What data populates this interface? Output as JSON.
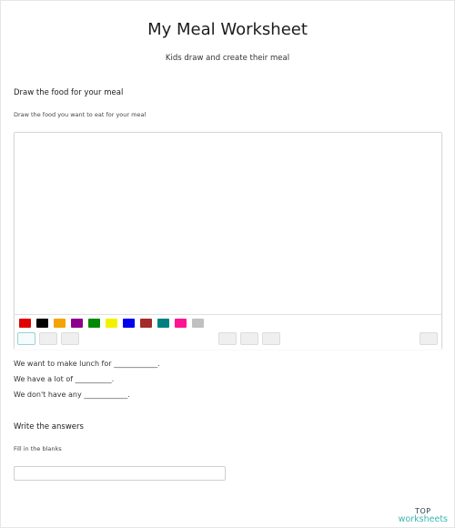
{
  "header": {
    "title": "My Meal Worksheet",
    "subtitle": "Kids draw and create their meal"
  },
  "draw_section": {
    "title": "Draw the food for your meal",
    "description": "Draw the food you want to eat for your meal",
    "palette": [
      "#e00000",
      "#000000",
      "#f4a300",
      "#8b008b",
      "#008a00",
      "#f2f200",
      "#0000ee",
      "#a52a2a",
      "#008080",
      "#ff1493",
      "#c0c0c0"
    ],
    "tools_left": [
      "pen-icon",
      "eraser-icon",
      "fill-icon"
    ],
    "tools_center": [
      "undo-icon",
      "redo-icon",
      "clear-icon"
    ],
    "tools_right": [
      "download-icon"
    ]
  },
  "sentences": [
    "We want to make lunch for ____________.",
    "We have a lot of __________.",
    "We don't have any ____________."
  ],
  "answers_section": {
    "title": "Write the answers",
    "description": "Fill in the blanks",
    "input_value": "",
    "input_placeholder": ""
  },
  "brand": {
    "top": "TOP",
    "bottom": "worksheets"
  }
}
